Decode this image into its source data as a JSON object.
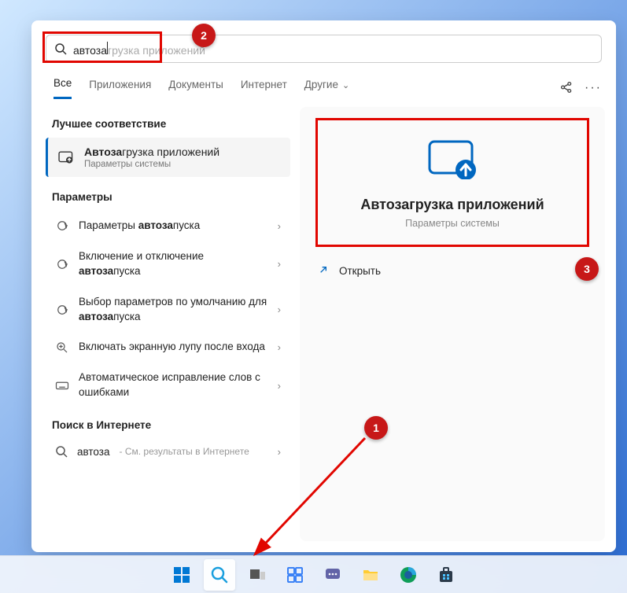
{
  "search": {
    "typed": "автоза",
    "ghost": "грузка приложений"
  },
  "tabs": {
    "items": [
      "Все",
      "Приложения",
      "Документы",
      "Интернет",
      "Другие"
    ],
    "active_index": 0
  },
  "left": {
    "best_match_header": "Лучшее соответствие",
    "best_match": {
      "title_bold": "Автоза",
      "title_rest": "грузка приложений",
      "subtitle": "Параметры системы"
    },
    "params_header": "Параметры",
    "params": [
      {
        "pre": "Параметры ",
        "bold": "автоза",
        "post": "пуска",
        "icon": "gear-rotate"
      },
      {
        "pre": "Включение и отключение ",
        "bold": "автоза",
        "post": "пуска",
        "icon": "gear-rotate"
      },
      {
        "pre": "Выбор параметров по умолчанию для ",
        "bold": "автоза",
        "post": "пуска",
        "icon": "gear-rotate"
      },
      {
        "pre": "Включать экранную лупу после входа",
        "bold": "",
        "post": "",
        "icon": "magnify-plus"
      },
      {
        "pre": "Автоматическое исправление слов с ошибками",
        "bold": "",
        "post": "",
        "icon": "keyboard"
      }
    ],
    "web_header": "Поиск в Интернете",
    "web": {
      "query": "автоза",
      "suffix": " - См. результаты в Интернете"
    }
  },
  "right": {
    "title": "Автозагрузка приложений",
    "subtitle": "Параметры системы",
    "open_label": "Открыть"
  },
  "annotations": {
    "badge1": "1",
    "badge2": "2",
    "badge3": "3"
  },
  "taskbar": {
    "items": [
      "start",
      "search",
      "taskview",
      "widgets",
      "chat",
      "explorer",
      "edge",
      "store"
    ]
  }
}
